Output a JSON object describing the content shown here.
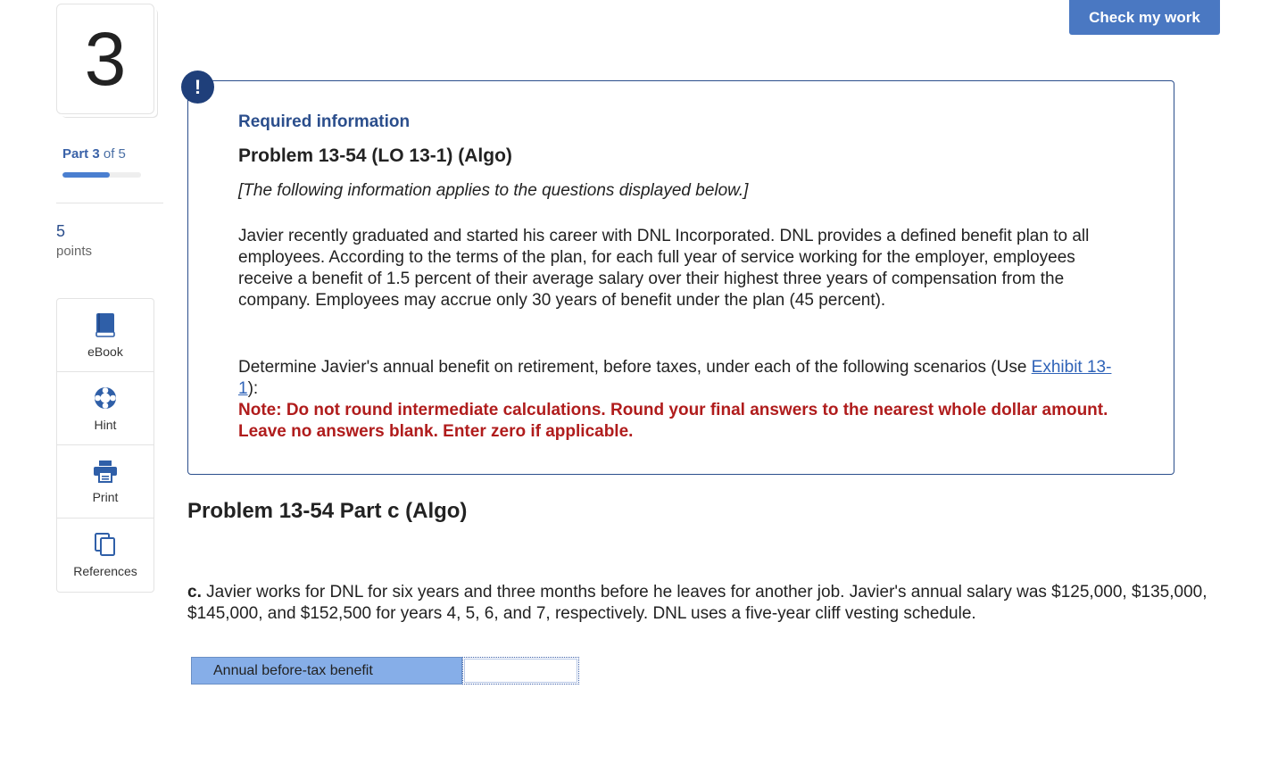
{
  "sidebar": {
    "question_number": "3",
    "part_word": "Part",
    "part_current": "3",
    "part_of": "of 5",
    "progress": 0.6,
    "points_value": "5",
    "points_label": "points",
    "tools": [
      {
        "label": "eBook",
        "icon": "book-icon"
      },
      {
        "label": "Hint",
        "icon": "lifebuoy-icon"
      },
      {
        "label": "Print",
        "icon": "printer-icon"
      },
      {
        "label": "References",
        "icon": "copy-pages-icon"
      }
    ]
  },
  "header": {
    "check_label": "Check my work"
  },
  "info_box": {
    "alert_symbol": "!",
    "heading": "Required information",
    "title": "Problem 13-54 (LO 13-1) (Algo)",
    "italic_note": "[The following information applies to the questions displayed below.]",
    "paragraph1": "Javier recently graduated and started his career with DNL Incorporated. DNL provides a defined benefit plan to all employees. According to the terms of the plan, for each full year of service working for the employer, employees receive a benefit of 1.5 percent of their average salary over their highest three years of compensation from the company. Employees may accrue only 30 years of benefit under the plan (45 percent).",
    "paragraph2_before": "Determine Javier's annual benefit on retirement, before taxes, under each of the following scenarios (Use ",
    "paragraph2_link": "Exhibit 13-1",
    "paragraph2_after": "):",
    "note": "Note: Do not round intermediate calculations. Round your final answers to the nearest whole dollar amount. Leave no answers blank. Enter zero if applicable."
  },
  "part": {
    "title": "Problem 13-54 Part c (Algo)",
    "question_prefix": "c.",
    "question_text": " Javier works for DNL for six years and three months before he leaves for another job. Javier's annual salary was $125,000, $135,000, $145,000, and $152,500 for years 4, 5, 6, and 7, respectively. DNL uses a five-year cliff vesting schedule.",
    "answer_label": "Annual before-tax benefit",
    "answer_value": ""
  },
  "colors": {
    "accent": "#4a78c2",
    "navy": "#2b4e8c",
    "note_red": "#b01c1c",
    "answer_label_bg": "#86aee8"
  }
}
